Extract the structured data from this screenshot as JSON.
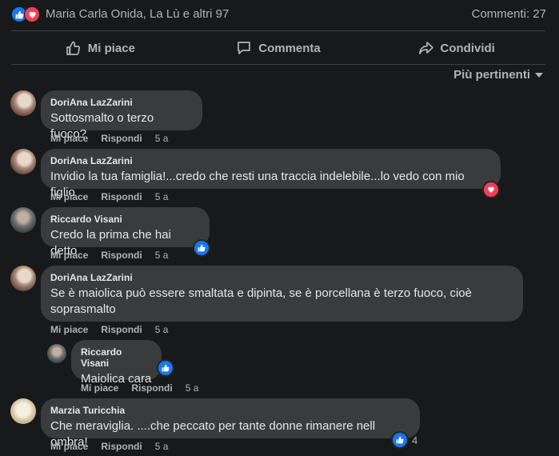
{
  "header": {
    "reaction_icons": [
      "like-icon",
      "love-icon"
    ],
    "reactors_text": "Maria Carla Onida, La Lù e altri 97",
    "comments_count_text": "Commenti: 27"
  },
  "actions": {
    "like_label": "Mi piace",
    "comment_label": "Commenta",
    "share_label": "Condividi"
  },
  "sort": {
    "label": "Più pertinenti"
  },
  "colors": {
    "like": "#1877f2",
    "love": "#f33e58",
    "bubble": "#3a3b3c",
    "background": "#18191a"
  },
  "comments": [
    {
      "author": "DoriAna LazZarini",
      "text": "Sottosmalto o terzo fuoco?",
      "like_label": "Mi piace",
      "reply_label": "Rispondi",
      "time": "5 a"
    },
    {
      "author": "DoriAna LazZarini",
      "text": "Invidio la tua famiglia!...credo che resti una traccia indelebile...lo vedo con mio figlio",
      "like_label": "Mi piace",
      "reply_label": "Rispondi",
      "time": "5 a",
      "reaction": "love-icon"
    },
    {
      "author": "Riccardo Visani",
      "text": "Credo la prima che hai detto",
      "like_label": "Mi piace",
      "reply_label": "Rispondi",
      "time": "5 a",
      "reaction": "like-icon"
    },
    {
      "author": "DoriAna LazZarini",
      "text": "Se è maiolica può essere smaltata e dipinta, se è porcellana è terzo fuoco, cioè soprasmalto",
      "like_label": "Mi piace",
      "reply_label": "Rispondi",
      "time": "5 a"
    },
    {
      "author": "Riccardo Visani",
      "text": "Maiolica cara",
      "like_label": "Mi piace",
      "reply_label": "Rispondi",
      "time": "5 a",
      "reaction": "like-icon"
    },
    {
      "author": "Marzia Turicchia",
      "text": "Che meraviglia. ....che peccato per tante donne rimanere nell ombra!",
      "like_label": "Mi piace",
      "reply_label": "Rispondi",
      "time": "5 a",
      "reaction": "like-icon",
      "reaction_count": "4"
    }
  ]
}
